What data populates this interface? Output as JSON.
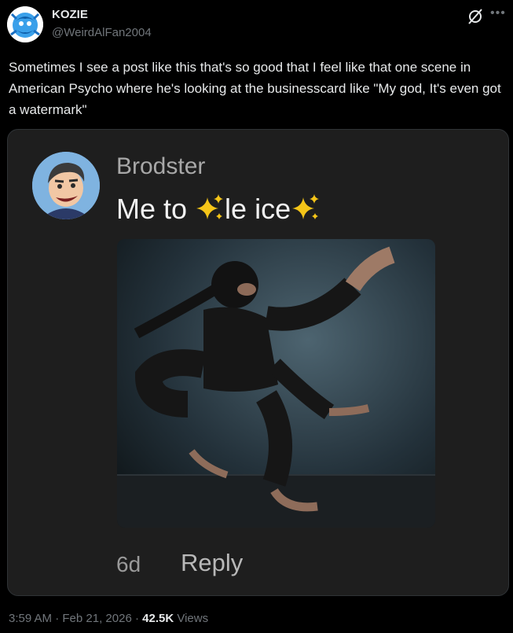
{
  "author": {
    "display_name": "KOZIE",
    "handle": "@WeirdAlFan2004"
  },
  "post": {
    "text": "Sometimes I see a post like this that's so good that I feel like that one scene in American Psycho where he's looking at the businesscard like \"My god, It's even got a watermark\""
  },
  "embedded": {
    "name": "Brodster",
    "text_before": "Me to ",
    "text_middle": "le ice",
    "time": "6d",
    "reply_label": "Reply"
  },
  "meta": {
    "time": "3:59 AM",
    "sep1": " · ",
    "date": "Feb 21, 2026",
    "sep2": " · ",
    "views": "42.5K",
    "views_label": " Views"
  },
  "icons": {
    "grok": "grok-icon",
    "more": "more-icon",
    "sparkle": "sparkles-emoji"
  },
  "colors": {
    "background": "#000000",
    "card": "#1e1e1e",
    "text": "#e7e9ea",
    "muted": "#71767b",
    "sparkle": "#f5c518"
  }
}
